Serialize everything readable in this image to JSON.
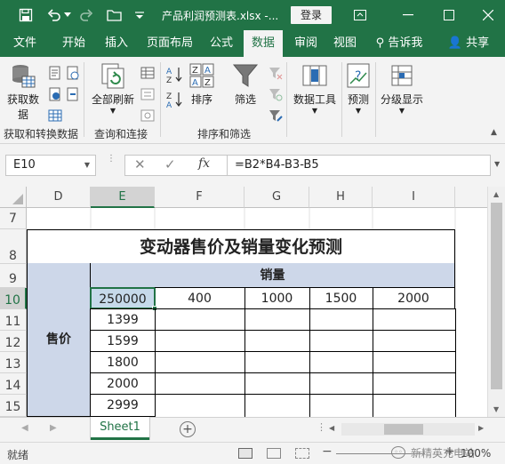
{
  "titlebar": {
    "title": "产品利润预测表.xlsx  -...",
    "login": "登录",
    "accent": "#217346"
  },
  "tabs": [
    "文件",
    "开始",
    "插入",
    "页面布局",
    "公式",
    "数据",
    "审阅",
    "视图"
  ],
  "tell_me": "告诉我",
  "share": "共享",
  "ribbon": {
    "get_data_line1": "获取数",
    "get_data_line2": "据",
    "refresh_all": "全部刷新",
    "sort": "排序",
    "filter": "筛选",
    "data_tools": "数据工具",
    "forecast": "预测",
    "outline": "分级显示",
    "group_get": "获取和转换数据",
    "group_query": "查询和连接",
    "group_sort": "排序和筛选"
  },
  "formula_bar": {
    "name_box": "E10",
    "formula": "=B2*B4-B3-B5"
  },
  "columns": [
    "D",
    "E",
    "F",
    "G",
    "H",
    "I"
  ],
  "rows": [
    "7",
    "8",
    "9",
    "10",
    "11",
    "12",
    "13",
    "14",
    "15"
  ],
  "sheet": {
    "title": "变动器售价及销量变化预测",
    "sales_header": "销量",
    "price_header": "售价",
    "corner_value": "250000",
    "sales_values": [
      "400",
      "1000",
      "1500",
      "2000"
    ],
    "price_values": [
      "1399",
      "1599",
      "1800",
      "2000",
      "2999"
    ],
    "header_fill": "#cdd7e9"
  },
  "sheet_tab": "Sheet1",
  "status": {
    "ready": "就绪",
    "zoom": "100%",
    "watermark": "新精英充电站"
  }
}
